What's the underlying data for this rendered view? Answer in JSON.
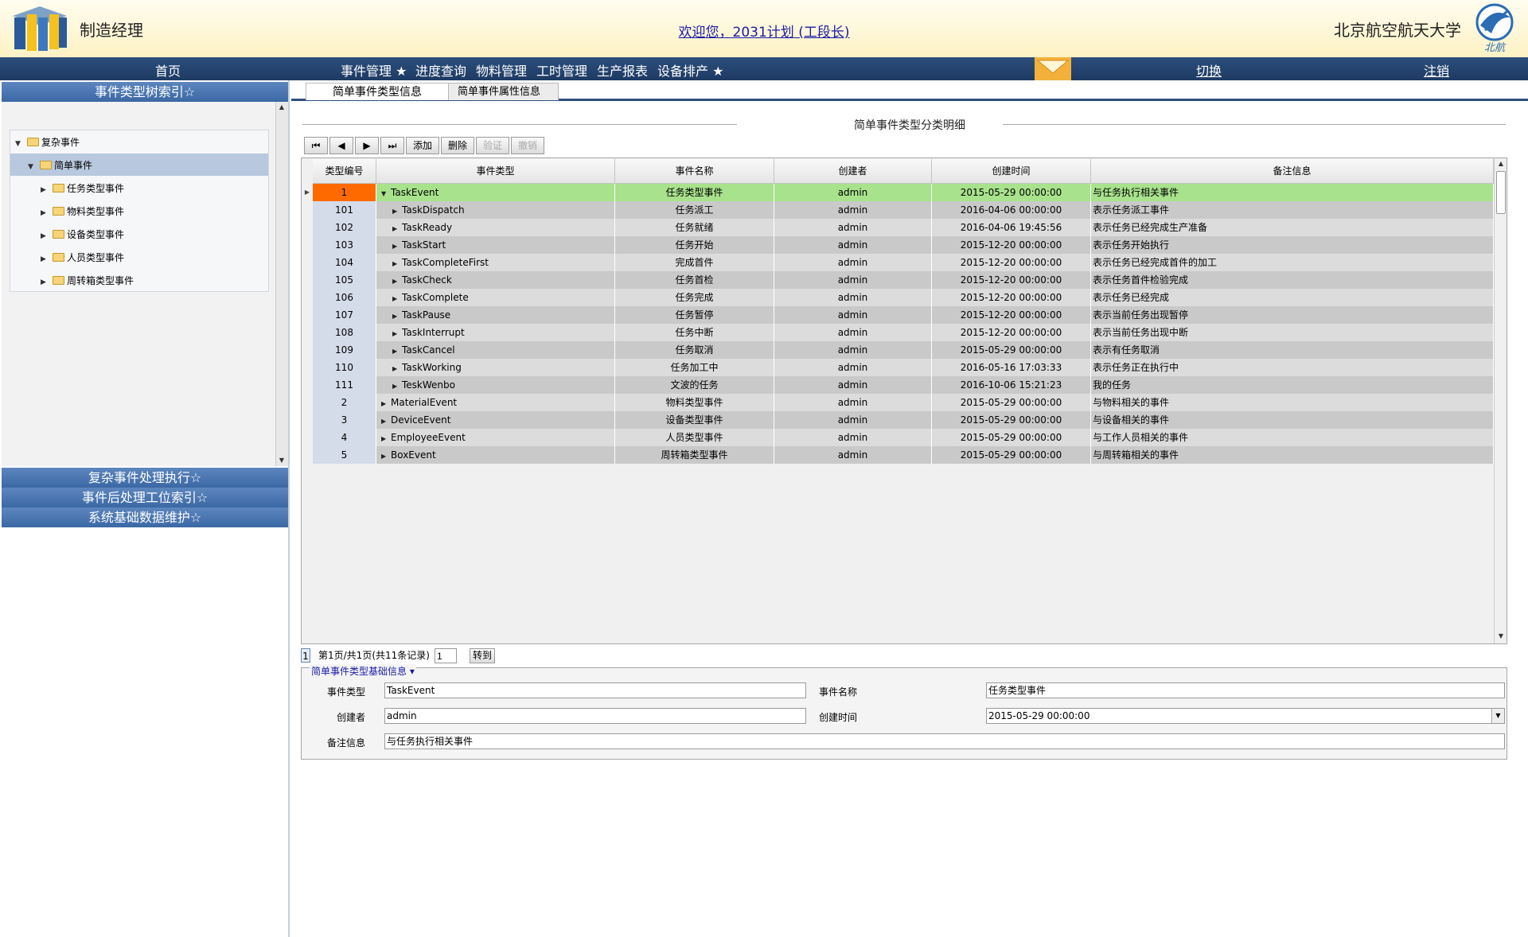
{
  "header": {
    "app_title": "制造经理",
    "welcome": "欢迎您，2031计划 (工段长)",
    "university": "北京航空航天大学",
    "univ_logo_text": "北航"
  },
  "nav": {
    "home": "首页",
    "items": [
      "事件管理 ★",
      "进度查询",
      "物料管理",
      "工时管理",
      "生产报表",
      "设备排产 ★"
    ],
    "switch": "切换",
    "logout": "注销"
  },
  "left": {
    "acc_tree": "事件类型树索引☆",
    "acc_complex_exec": "复杂事件处理执行☆",
    "acc_post_station": "事件后处理工位索引☆",
    "acc_basic_data": "系统基础数据维护☆",
    "tree": {
      "root": "复杂事件",
      "simple": "简单事件",
      "children": [
        "任务类型事件",
        "物料类型事件",
        "设备类型事件",
        "人员类型事件",
        "周转箱类型事件"
      ]
    }
  },
  "main": {
    "tabs": [
      "简单事件类型信息",
      "简单事件属性信息"
    ],
    "section_title": "简单事件类型分类明细",
    "toolbar": {
      "first": "⏮",
      "prev": "◀",
      "next": "▶",
      "last": "⏭",
      "add": "添加",
      "delete": "删除",
      "verify": "验证",
      "cancel": "撤销"
    },
    "columns": [
      "类型编号",
      "事件类型",
      "事件名称",
      "创建者",
      "创建时间",
      "备注信息"
    ],
    "rows": [
      {
        "id": "1",
        "type": "TaskEvent",
        "name": "任务类型事件",
        "creator": "admin",
        "time": "2015-05-29 00:00:00",
        "note": "与任务执行相关事件"
      },
      {
        "id": "101",
        "type": "TaskDispatch",
        "name": "任务派工",
        "creator": "admin",
        "time": "2016-04-06 00:00:00",
        "note": "表示任务派工事件"
      },
      {
        "id": "102",
        "type": "TaskReady",
        "name": "任务就绪",
        "creator": "admin",
        "time": "2016-04-06 19:45:56",
        "note": "表示任务已经完成生产准备"
      },
      {
        "id": "103",
        "type": "TaskStart",
        "name": "任务开始",
        "creator": "admin",
        "time": "2015-12-20 00:00:00",
        "note": "表示任务开始执行"
      },
      {
        "id": "104",
        "type": "TaskCompleteFirst",
        "name": "完成首件",
        "creator": "admin",
        "time": "2015-12-20 00:00:00",
        "note": "表示任务已经完成首件的加工"
      },
      {
        "id": "105",
        "type": "TaskCheck",
        "name": "任务首检",
        "creator": "admin",
        "time": "2015-12-20 00:00:00",
        "note": "表示任务首件检验完成"
      },
      {
        "id": "106",
        "type": "TaskComplete",
        "name": "任务完成",
        "creator": "admin",
        "time": "2015-12-20 00:00:00",
        "note": "表示任务已经完成"
      },
      {
        "id": "107",
        "type": "TaskPause",
        "name": "任务暂停",
        "creator": "admin",
        "time": "2015-12-20 00:00:00",
        "note": "表示当前任务出现暂停"
      },
      {
        "id": "108",
        "type": "TaskInterrupt",
        "name": "任务中断",
        "creator": "admin",
        "time": "2015-12-20 00:00:00",
        "note": "表示当前任务出现中断"
      },
      {
        "id": "109",
        "type": "TaskCancel",
        "name": "任务取消",
        "creator": "admin",
        "time": "2015-05-29 00:00:00",
        "note": "表示有任务取消"
      },
      {
        "id": "110",
        "type": "TaskWorking",
        "name": "任务加工中",
        "creator": "admin",
        "time": "2016-05-16 17:03:33",
        "note": "表示任务正在执行中"
      },
      {
        "id": "111",
        "type": "TeskWenbo",
        "name": "文波的任务",
        "creator": "admin",
        "time": "2016-10-06 15:21:23",
        "note": "我的任务"
      },
      {
        "id": "2",
        "type": "MaterialEvent",
        "name": "物料类型事件",
        "creator": "admin",
        "time": "2015-05-29 00:00:00",
        "note": "与物料相关的事件"
      },
      {
        "id": "3",
        "type": "DeviceEvent",
        "name": "设备类型事件",
        "creator": "admin",
        "time": "2015-05-29 00:00:00",
        "note": "与设备相关的事件"
      },
      {
        "id": "4",
        "type": "EmployeeEvent",
        "name": "人员类型事件",
        "creator": "admin",
        "time": "2015-05-29 00:00:00",
        "note": "与工作人员相关的事件"
      },
      {
        "id": "5",
        "type": "BoxEvent",
        "name": "周转箱类型事件",
        "creator": "admin",
        "time": "2015-05-29 00:00:00",
        "note": "与周转箱相关的事件"
      }
    ],
    "pager": {
      "current": "1",
      "info": "第1页/共1页(共11条记录)",
      "input": "1",
      "go": "转到"
    },
    "form": {
      "legend": "简单事件类型基础信息 ▾",
      "label_type": "事件类型",
      "value_type": "TaskEvent",
      "label_name": "事件名称",
      "value_name": "任务类型事件",
      "label_creator": "创建者",
      "value_creator": "admin",
      "label_time": "创建时间",
      "value_time": "2015-05-29 00:00:00",
      "label_note": "备注信息",
      "value_note": "与任务执行相关事件"
    }
  },
  "colors": {
    "nav_bg": "#1d3a63",
    "accordion_bg": "#3b68a4",
    "selected_row": "#a8e28c",
    "selected_id": "#ff6a00",
    "mail_icon": "#f3b03b"
  }
}
